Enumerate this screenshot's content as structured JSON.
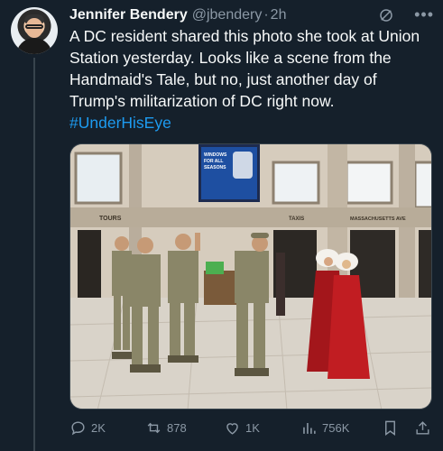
{
  "author": {
    "name": "Jennifer Bendery",
    "handle": "@jbendery",
    "separator": "·",
    "time": "2h"
  },
  "post": {
    "text": "A DC resident shared this photo she took at Union Station yesterday. Looks like a scene from the Handmaid's Tale, but no, just another day of Trump's militarization of DC right now.",
    "hashtag": "#UnderHisEye"
  },
  "media": {
    "signs": {
      "left": "TOURS",
      "middle": "TAXIS",
      "right": "MASSACHUSETTS AVE"
    },
    "screen_text": [
      "WINDOWS",
      "FOR ALL",
      "SEASONS"
    ]
  },
  "actions": {
    "replies": "2K",
    "reposts": "878",
    "likes": "1K",
    "views": "756K"
  },
  "icons": {
    "grok": "grok-icon",
    "more": "more-icon",
    "reply": "reply-icon",
    "repost": "repost-icon",
    "like": "heart-icon",
    "views": "analytics-icon",
    "bookmark": "bookmark-icon",
    "share": "share-icon"
  },
  "colors": {
    "background": "#15202b",
    "text": "#f7f9f9",
    "secondary": "#8b98a5",
    "link": "#1d9bf0"
  }
}
